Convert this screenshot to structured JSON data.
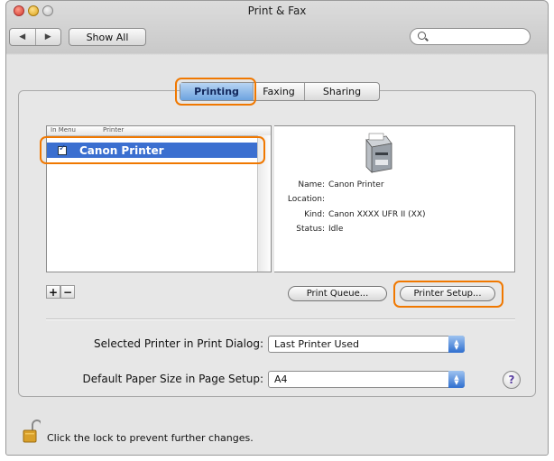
{
  "window": {
    "title": "Print & Fax"
  },
  "toolbar": {
    "back_label": "◀",
    "forward_label": "▶",
    "show_all_label": "Show All"
  },
  "tabs": [
    {
      "label": "Printing",
      "active": true
    },
    {
      "label": "Faxing",
      "active": false
    },
    {
      "label": "Sharing",
      "active": false
    }
  ],
  "printer_list": {
    "headers": [
      "In Menu",
      "Printer"
    ],
    "rows": [
      {
        "name": "Canon Printer",
        "in_menu": true,
        "selected": true
      }
    ]
  },
  "printer_details": {
    "name_label": "Name:",
    "name_value": "Canon Printer",
    "location_label": "Location:",
    "location_value": "",
    "kind_label": "Kind:",
    "kind_value": "Canon XXXX UFR II (XX)",
    "status_label": "Status:",
    "status_value": "Idle"
  },
  "list_controls": {
    "add_label": "+",
    "remove_label": "−"
  },
  "buttons": {
    "print_queue_label": "Print Queue...",
    "printer_setup_label": "Printer Setup..."
  },
  "settings": {
    "selected_printer_label": "Selected Printer in Print Dialog:",
    "selected_printer_value": "Last Printer Used",
    "paper_size_label": "Default Paper Size in Page Setup:",
    "paper_size_value": "A4"
  },
  "help_label": "?",
  "lock_text": "Click the lock to prevent further changes.",
  "colors": {
    "highlight": "#f07800",
    "selection": "#3b6fd0"
  }
}
